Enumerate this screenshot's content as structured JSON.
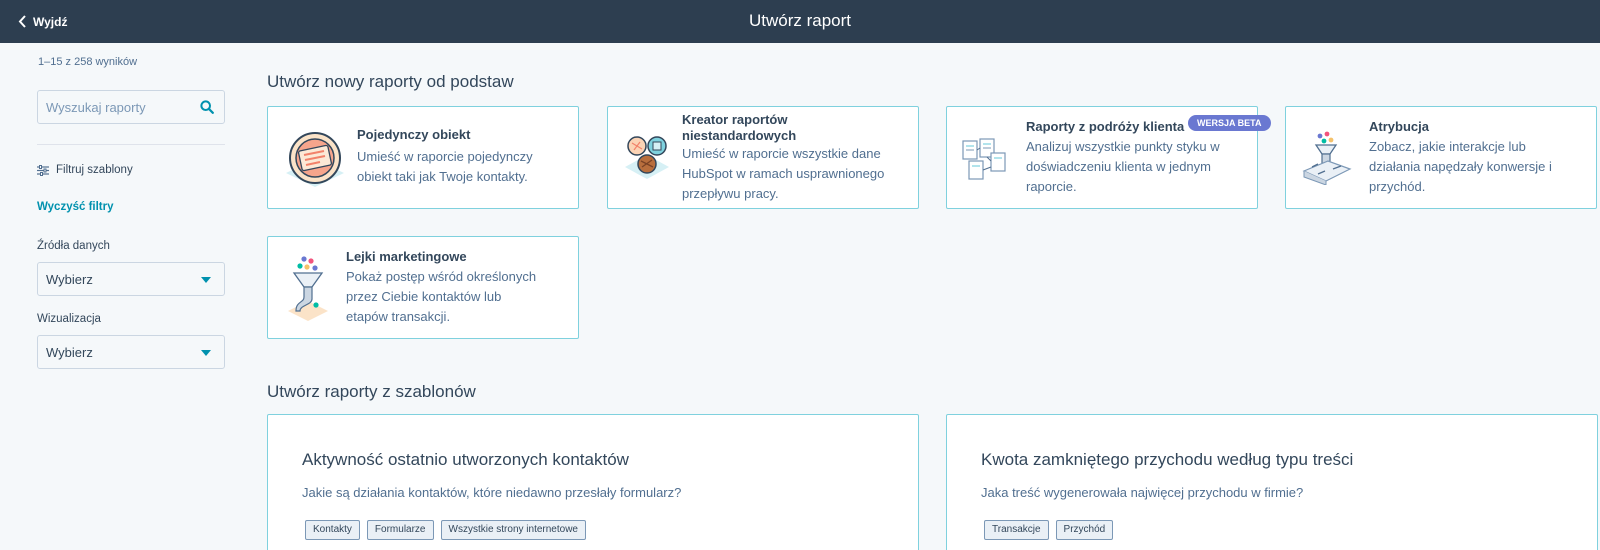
{
  "topbar": {
    "back_label": "Wyjdź",
    "title": "Utwórz raport"
  },
  "sidebar": {
    "result_count": "1–15 z 258 wyników",
    "search_placeholder": "Wyszukaj raporty",
    "filter_templates_label": "Filtruj szablony",
    "clear_filters_label": "Wyczyść filtry",
    "data_sources": {
      "label": "Źródła danych",
      "value": "Wybierz"
    },
    "visualization": {
      "label": "Wizualizacja",
      "value": "Wybierz"
    }
  },
  "scratch_section": {
    "title": "Utwórz nowy raporty od podstaw",
    "cards": [
      {
        "title": "Pojedynczy obiekt",
        "desc_lines": [
          "Umieść w raporcie pojedynczy",
          "obiekt taki jak Twoje kontakty."
        ]
      },
      {
        "title_lines": [
          "Kreator raportów",
          "niestandardowych"
        ],
        "desc_lines": [
          "Umieść w raporcie wszystkie dane",
          "HubSpot w ramach usprawnionego",
          "przepływu pracy."
        ]
      },
      {
        "title": "Raporty z podróży klienta",
        "badge": "WERSJA BETA",
        "desc_lines": [
          "Analizuj wszystkie punkty styku w",
          "doświadczeniu klienta w jednym",
          "raporcie."
        ]
      },
      {
        "title": "Atrybucja",
        "desc_lines": [
          "Zobacz, jakie interakcje lub",
          "działania napędzały konwersje i",
          "przychód."
        ]
      },
      {
        "title": "Lejki marketingowe",
        "desc_lines": [
          "Pokaż postęp wśród określonych",
          "przez Ciebie kontaktów lub",
          "etapów transakcji."
        ]
      }
    ]
  },
  "template_section": {
    "title": "Utwórz raporty z szablonów",
    "cards": [
      {
        "title": "Aktywność ostatnio utworzonych kontaktów",
        "desc": "Jakie są działania kontaktów, które niedawno przesłały formularz?",
        "tags": [
          "Kontakty",
          "Formularze",
          "Wszystkie strony internetowe"
        ]
      },
      {
        "title": "Kwota zamkniętego przychodu według typu treści",
        "desc": "Jaka treść wygenerowała najwięcej przychodu w firmie?",
        "tags": [
          "Transakcje",
          "Przychód"
        ]
      }
    ]
  },
  "colors": {
    "topbar": "#2d3e50",
    "accent": "#0091ae",
    "card_border": "#7fd1de",
    "beta_badge": "#6a78d1"
  }
}
